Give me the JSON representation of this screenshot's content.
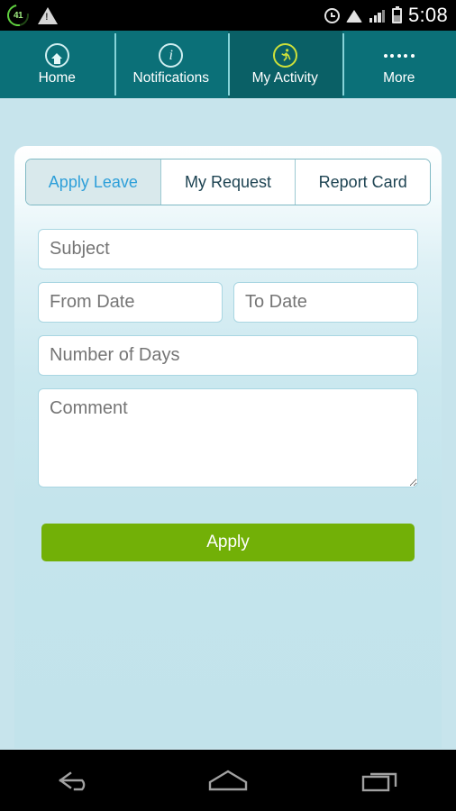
{
  "status_bar": {
    "download_badge": "41",
    "time": "5:08",
    "icons": [
      "download-progress-icon",
      "warning-icon",
      "alarm-icon",
      "wifi-icon",
      "signal-icon",
      "battery-icon"
    ]
  },
  "top_nav": {
    "active_index": 2,
    "items": [
      {
        "label": "Home",
        "icon": "home-icon"
      },
      {
        "label": "Notifications",
        "icon": "info-icon"
      },
      {
        "label": "My Activity",
        "icon": "running-person-icon"
      },
      {
        "label": "More",
        "icon": "more-dots-icon"
      }
    ]
  },
  "tabs": {
    "active_index": 0,
    "items": [
      {
        "label": "Apply Leave"
      },
      {
        "label": "My Request"
      },
      {
        "label": "Report Card"
      }
    ]
  },
  "form": {
    "subject": {
      "value": "",
      "placeholder": "Subject"
    },
    "from_date": {
      "value": "",
      "placeholder": "From Date"
    },
    "to_date": {
      "value": "",
      "placeholder": "To Date"
    },
    "number_of_days": {
      "value": "",
      "placeholder": "Number of Days"
    },
    "comment": {
      "value": "",
      "placeholder": "Comment"
    },
    "submit_label": "Apply"
  },
  "system_nav": {
    "back": "back-icon",
    "home": "home-icon",
    "recents": "recents-icon"
  },
  "colors": {
    "nav_teal": "#0b7078",
    "nav_teal_active": "#0a6066",
    "page_blue": "#c7e4ec",
    "accent_green": "#72b007",
    "tab_active_text": "#2e9fd9",
    "activity_icon": "#cde03a"
  }
}
